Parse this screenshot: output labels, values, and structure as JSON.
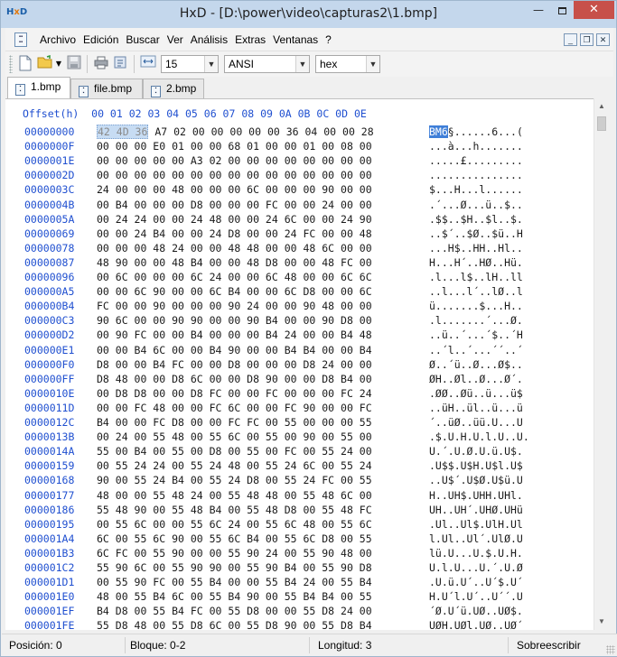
{
  "window": {
    "title": "HxD - [D:\\power\\video\\capturas2\\1.bmp]",
    "logo_h": "H",
    "logo_x": "x",
    "logo_d": "D",
    "minimize_glyph": "—",
    "close_glyph": "✕"
  },
  "menu": [
    "Archivo",
    "Edición",
    "Buscar",
    "Ver",
    "Análisis",
    "Extras",
    "Ventanas",
    "?"
  ],
  "mdi_controls": {
    "minimize": "_",
    "restore": "❐",
    "close": "✕"
  },
  "toolbar": {
    "bytes_per_row": "15",
    "charset": "ANSI",
    "offset_base": "hex",
    "icons": [
      "new-file-icon",
      "open-folder-icon",
      "save-icon",
      "print-icon",
      "properties-icon",
      "bytes-per-row-icon"
    ],
    "colors": {
      "offset": "#1f4fd0",
      "selection_ascii": "#3f7fd8",
      "selection_hex": "#c7dcf3"
    }
  },
  "tabs": [
    {
      "label": "1.bmp",
      "active": true
    },
    {
      "label": "file.bmp",
      "active": false
    },
    {
      "label": "2.bmp",
      "active": false
    }
  ],
  "editor": {
    "header": "Offset(h)  00 01 02 03 04 05 06 07 08 09 0A 0B 0C 0D 0E",
    "selection": {
      "start": 0,
      "length": 3
    },
    "rows": [
      {
        "offset": "00000000",
        "hex": "42 4D 36 A7 02 00 00 00 00 00 36 04 00 00 28",
        "ascii": "BM6§......6...("
      },
      {
        "offset": "0000000F",
        "hex": "00 00 00 E0 01 00 00 68 01 00 00 01 00 08 00",
        "ascii": "...à...h......."
      },
      {
        "offset": "0000001E",
        "hex": "00 00 00 00 00 A3 02 00 00 00 00 00 00 00 00",
        "ascii": ".....£........."
      },
      {
        "offset": "0000002D",
        "hex": "00 00 00 00 00 00 00 00 00 00 00 00 00 00 00",
        "ascii": "..............."
      },
      {
        "offset": "0000003C",
        "hex": "24 00 00 00 48 00 00 00 6C 00 00 00 90 00 00",
        "ascii": "$...H...l......"
      },
      {
        "offset": "0000004B",
        "hex": "00 B4 00 00 00 D8 00 00 00 FC 00 00 24 00 00",
        "ascii": ".´...Ø...ü..$.."
      },
      {
        "offset": "0000005A",
        "hex": "00 24 24 00 00 24 48 00 00 24 6C 00 00 24 90",
        "ascii": ".$$..$H..$l..$."
      },
      {
        "offset": "00000069",
        "hex": "00 00 24 B4 00 00 24 D8 00 00 24 FC 00 00 48",
        "ascii": "..$´..$Ø..$ü..H"
      },
      {
        "offset": "00000078",
        "hex": "00 00 00 48 24 00 00 48 48 00 00 48 6C 00 00",
        "ascii": "...H$..HH..Hl.."
      },
      {
        "offset": "00000087",
        "hex": "48 90 00 00 48 B4 00 00 48 D8 00 00 48 FC 00",
        "ascii": "H...H´..HØ..Hü."
      },
      {
        "offset": "00000096",
        "hex": "00 6C 00 00 00 6C 24 00 00 6C 48 00 00 6C 6C",
        "ascii": ".l...l$..lH..ll"
      },
      {
        "offset": "000000A5",
        "hex": "00 00 6C 90 00 00 6C B4 00 00 6C D8 00 00 6C",
        "ascii": "..l...l´..lØ..l"
      },
      {
        "offset": "000000B4",
        "hex": "FC 00 00 90 00 00 00 90 24 00 00 90 48 00 00",
        "ascii": "ü.......$...H.."
      },
      {
        "offset": "000000C3",
        "hex": "90 6C 00 00 90 90 00 00 90 B4 00 00 90 D8 00",
        "ascii": ".l.......´...Ø."
      },
      {
        "offset": "000000D2",
        "hex": "00 90 FC 00 00 B4 00 00 00 B4 24 00 00 B4 48",
        "ascii": "..ü..´...´$..´H"
      },
      {
        "offset": "000000E1",
        "hex": "00 00 B4 6C 00 00 B4 90 00 00 B4 B4 00 00 B4",
        "ascii": "..´l..´...´´..´"
      },
      {
        "offset": "000000F0",
        "hex": "D8 00 00 B4 FC 00 00 D8 00 00 00 D8 24 00 00",
        "ascii": "Ø..´ü..Ø...Ø$.."
      },
      {
        "offset": "000000FF",
        "hex": "D8 48 00 00 D8 6C 00 00 D8 90 00 00 D8 B4 00",
        "ascii": "ØH..Øl..Ø...Ø´."
      },
      {
        "offset": "0000010E",
        "hex": "00 D8 D8 00 00 D8 FC 00 00 FC 00 00 00 FC 24",
        "ascii": ".ØØ..Øü..ü...ü$"
      },
      {
        "offset": "0000011D",
        "hex": "00 00 FC 48 00 00 FC 6C 00 00 FC 90 00 00 FC",
        "ascii": "..üH..ül..ü...ü"
      },
      {
        "offset": "0000012C",
        "hex": "B4 00 00 FC D8 00 00 FC FC 00 55 00 00 00 55",
        "ascii": "´..üØ..üü.U...U"
      },
      {
        "offset": "0000013B",
        "hex": "00 24 00 55 48 00 55 6C 00 55 00 90 00 55 00",
        "ascii": ".$.U.H.U.l.U..U."
      },
      {
        "offset": "0000014A",
        "hex": "55 00 B4 00 55 00 D8 00 55 00 FC 00 55 24 00",
        "ascii": "U.´.U.Ø.U.ü.U$."
      },
      {
        "offset": "00000159",
        "hex": "00 55 24 24 00 55 24 48 00 55 24 6C 00 55 24",
        "ascii": ".U$$.U$H.U$l.U$"
      },
      {
        "offset": "00000168",
        "hex": "90 00 55 24 B4 00 55 24 D8 00 55 24 FC 00 55",
        "ascii": "..U$´.U$Ø.U$ü.U"
      },
      {
        "offset": "00000177",
        "hex": "48 00 00 55 48 24 00 55 48 48 00 55 48 6C 00",
        "ascii": "H..UH$.UHH.UHl."
      },
      {
        "offset": "00000186",
        "hex": "55 48 90 00 55 48 B4 00 55 48 D8 00 55 48 FC",
        "ascii": "UH..UH´.UHØ.UHü"
      },
      {
        "offset": "00000195",
        "hex": "00 55 6C 00 00 55 6C 24 00 55 6C 48 00 55 6C",
        "ascii": ".Ul..Ul$.UlH.Ul"
      },
      {
        "offset": "000001A4",
        "hex": "6C 00 55 6C 90 00 55 6C B4 00 55 6C D8 00 55",
        "ascii": "l.Ul..Ul´.UlØ.U"
      },
      {
        "offset": "000001B3",
        "hex": "6C FC 00 55 90 00 00 55 90 24 00 55 90 48 00",
        "ascii": "lü.U...U.$.U.H."
      },
      {
        "offset": "000001C2",
        "hex": "55 90 6C 00 55 90 90 00 55 90 B4 00 55 90 D8",
        "ascii": "U.l.U...U.´.U.Ø"
      },
      {
        "offset": "000001D1",
        "hex": "00 55 90 FC 00 55 B4 00 00 55 B4 24 00 55 B4",
        "ascii": ".U.ü.U´..U´$.U´"
      },
      {
        "offset": "000001E0",
        "hex": "48 00 55 B4 6C 00 55 B4 90 00 55 B4 B4 00 55",
        "ascii": "H.U´l.U´..U´´.U"
      },
      {
        "offset": "000001EF",
        "hex": "B4 D8 00 55 B4 FC 00 55 D8 00 00 55 D8 24 00",
        "ascii": "´Ø.U´ü.UØ..UØ$."
      },
      {
        "offset": "000001FE",
        "hex": "55 D8 48 00 55 D8 6C 00 55 D8 90 00 55 D8 B4",
        "ascii": "UØH.UØl.UØ..UØ´"
      }
    ]
  },
  "status": {
    "position": "Posición: 0",
    "block": "Bloque: 0-2",
    "length": "Longitud: 3",
    "mode": "Sobreescribir"
  }
}
